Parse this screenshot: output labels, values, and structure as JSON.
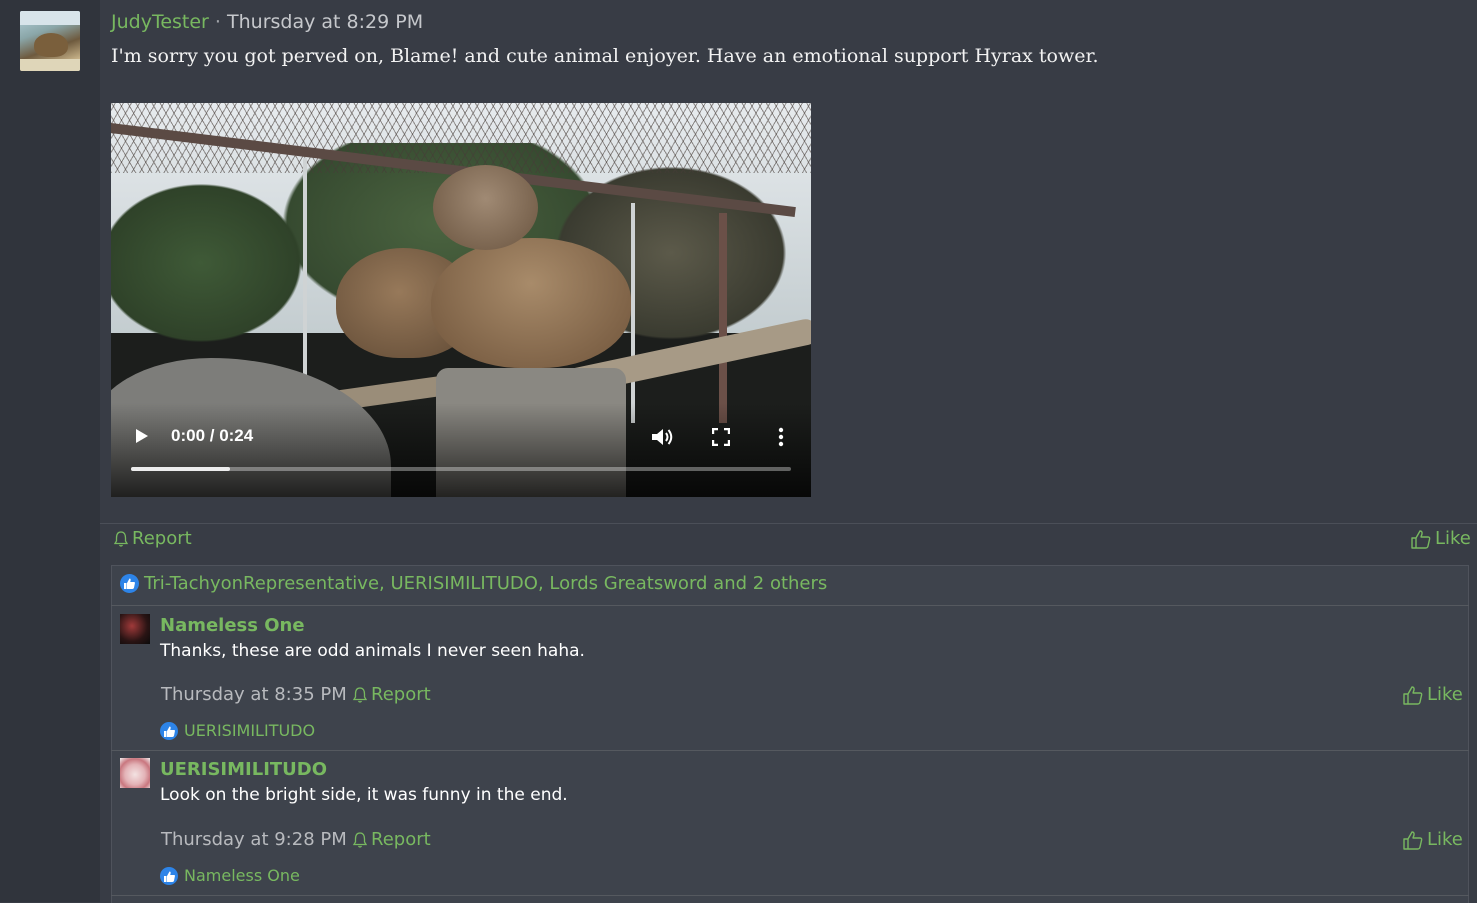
{
  "post": {
    "author": "JudyTester",
    "separator": "·",
    "time": "Thursday at 8:29 PM",
    "body": "I'm sorry you got perved on, Blame! and cute animal enjoyer. Have an emotional support Hyrax tower.",
    "report_label": "Report",
    "like_label": "Like"
  },
  "video": {
    "time_display": "0:00 / 0:24",
    "buffered_fraction": 0.15,
    "played_fraction": 0
  },
  "reactions": {
    "users_text": "Tri-TachyonRepresentative, UERISIMILITUDO, Lords Greatsword and 2 others"
  },
  "comments": [
    {
      "author": "Nameless One",
      "text": "Thanks, these are odd animals I never seen haha.",
      "time": "Thursday at 8:35 PM",
      "report_label": "Report",
      "like_label": "Like",
      "reactions": "UERISIMILITUDO"
    },
    {
      "author": "UERISIMILITUDO",
      "text": "Look on the bright side, it was funny in the end.",
      "time": "Thursday at 9:28 PM",
      "report_label": "Report",
      "like_label": "Like",
      "reactions": "Nameless One"
    }
  ],
  "colors": {
    "accent_green": "#78b860",
    "background": "#383c45",
    "reaction_blue": "#2d84e8"
  },
  "icons": {
    "report": "bell-icon",
    "like": "thumbs-up-outline-icon",
    "reaction": "thumbs-up-filled-icon",
    "video_play": "play-icon",
    "video_volume": "volume-icon",
    "video_fullscreen": "fullscreen-icon",
    "video_menu": "more-vertical-icon"
  }
}
